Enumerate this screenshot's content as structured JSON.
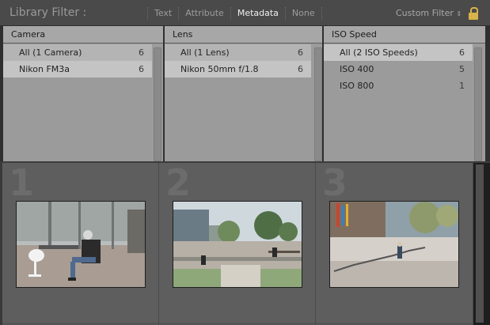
{
  "toolbar": {
    "title": "Library Filter :",
    "modes": [
      "Text",
      "Attribute",
      "Metadata",
      "None"
    ],
    "active_mode": "Metadata",
    "preset": "Custom Filter",
    "preset_chevron": "⇕",
    "lock_icon": "lock-icon"
  },
  "columns": [
    {
      "header": "Camera",
      "items": [
        {
          "label": "All (1 Camera)",
          "count": "6"
        },
        {
          "label": "Nikon FM3a",
          "count": "6"
        }
      ]
    },
    {
      "header": "Lens",
      "items": [
        {
          "label": "All (1 Lens)",
          "count": "6"
        },
        {
          "label": "Nikon 50mm f/1.8",
          "count": "6"
        }
      ]
    },
    {
      "header": "ISO Speed",
      "items": [
        {
          "label": "All (2 ISO Speeds)",
          "count": "6"
        },
        {
          "label": "ISO 400",
          "count": "5"
        },
        {
          "label": "ISO 800",
          "count": "1"
        }
      ]
    }
  ],
  "grid": {
    "cells": [
      {
        "number": "1"
      },
      {
        "number": "2"
      },
      {
        "number": "3"
      }
    ]
  },
  "colors": {
    "lock": "#d8b24a",
    "panel": "#9b9b9b"
  }
}
